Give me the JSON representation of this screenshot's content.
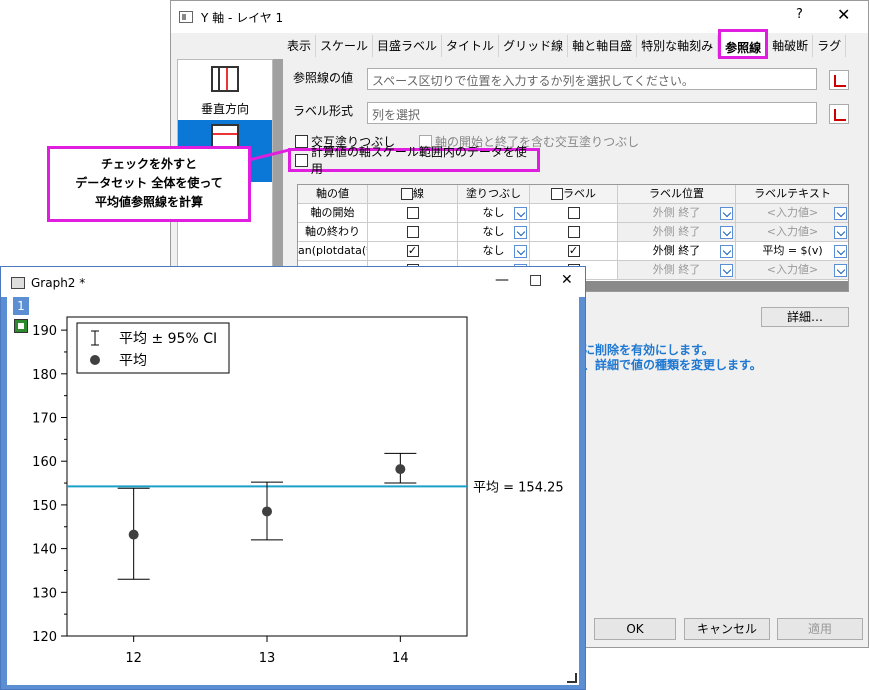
{
  "dialog": {
    "title": "Y 軸 - レイヤ 1",
    "help_label": "?",
    "close_label": "✕",
    "tabs": [
      "表示",
      "スケール",
      "目盛ラベル",
      "タイトル",
      "グリッド線",
      "軸と軸目盛",
      "特別な軸刻み",
      "参照線",
      "軸破断",
      "ラグ"
    ],
    "active_tab": "参照線",
    "left_items": [
      {
        "label": "垂直方向"
      },
      {
        "label": ""
      }
    ],
    "ref_values_label": "参照線の値",
    "ref_values_placeholder": "スペース区切りで位置を入力するか列を選択してください。",
    "label_format_label": "ラベル形式",
    "label_format_placeholder": "列を選択",
    "alt_fill_label": "交互塗りつぶし",
    "alt_fill_axis_label": "軸の開始と終了を含む交互塗りつぶし",
    "use_calc_label": "計算値の軸スケール範囲内のデータを使用",
    "grid": {
      "headers": [
        "軸の値",
        "線",
        "塗りつぶし",
        "ラベル",
        "ラベル位置",
        "ラベルテキスト"
      ],
      "rows": [
        {
          "value": "軸の開始",
          "line": false,
          "fill": "なし",
          "label": false,
          "pos": "外側 終了",
          "text": "<入力値>",
          "muted": true
        },
        {
          "value": "軸の終わり",
          "line": false,
          "fill": "なし",
          "label": false,
          "pos": "外側 終了",
          "text": "<入力値>",
          "muted": true
        },
        {
          "value": "an(plotdata(*,",
          "line": true,
          "fill": "なし",
          "label": true,
          "pos": "外側 終了",
          "text": "平均 = $(v)",
          "muted": false
        },
        {
          "value": "",
          "line": false,
          "fill": "",
          "label": false,
          "pos": "外側 終了",
          "text": "<入力値>",
          "muted": true
        }
      ]
    },
    "detail_button": "詳細…",
    "notes": [
      "に削除を有効にします。",
      "、詳細で値の種類を変更します。"
    ],
    "buttons": {
      "ok": "OK",
      "cancel": "キャンセル",
      "apply": "適用"
    }
  },
  "callout": {
    "lines": [
      "チェックを外すと",
      "データセット 全体を使って",
      "平均値参照線を計算"
    ]
  },
  "graph_window": {
    "title": "Graph2 *",
    "layer": "1",
    "min_label": "—",
    "max_label": "□",
    "close_label": "✕"
  },
  "chart_data": {
    "type": "scatter",
    "x": [
      12,
      13,
      14
    ],
    "y": [
      143.2,
      148.5,
      158.2
    ],
    "ci_low": [
      133,
      142,
      155
    ],
    "ci_high": [
      153.8,
      155.2,
      161.8
    ],
    "xlim": [
      11.5,
      14.5
    ],
    "ylim": [
      120,
      193
    ],
    "yticks": [
      120,
      130,
      140,
      150,
      160,
      170,
      180,
      190
    ],
    "xticks": [
      12,
      13,
      14
    ],
    "legend": [
      "平均 ± 95% CI",
      "平均"
    ],
    "legend_position": "top-left",
    "reference_line": {
      "value": 154.25,
      "label": "平均 = 154.25",
      "color": "#1aa1c9"
    },
    "colors": {
      "marker": "#404040",
      "axis": "#000000"
    }
  }
}
